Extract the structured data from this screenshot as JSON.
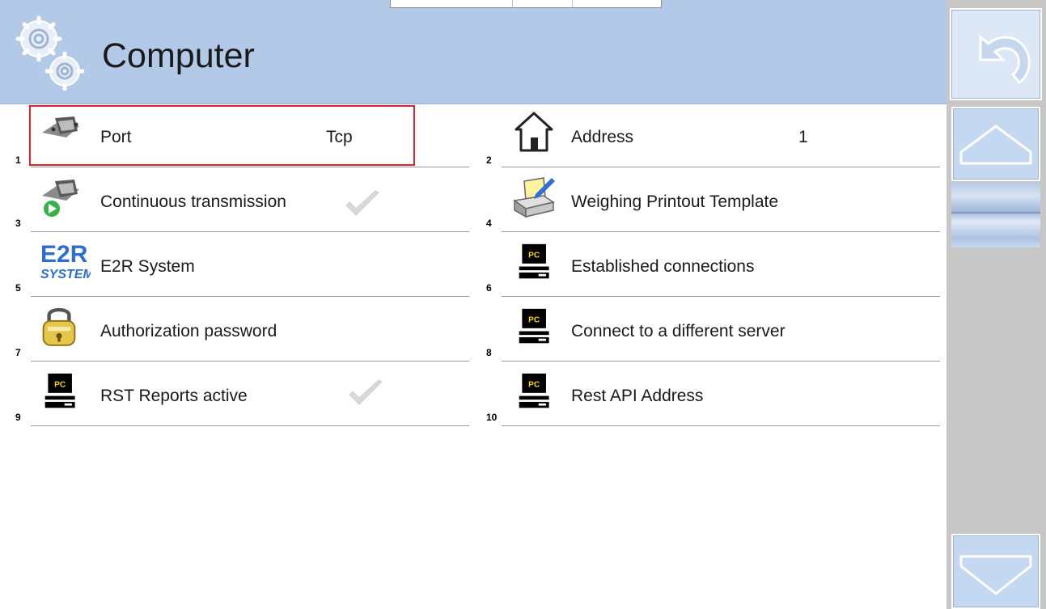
{
  "header": {
    "title": "Computer"
  },
  "items": [
    {
      "num": "1",
      "label": "Port",
      "value": "Tcp",
      "icon": "serial-port-icon",
      "checked": false
    },
    {
      "num": "2",
      "label": "Address",
      "value": "1",
      "icon": "home-icon",
      "checked": false
    },
    {
      "num": "3",
      "label": "Continuous transmission",
      "value": "",
      "icon": "serial-port-play-icon",
      "checked": true
    },
    {
      "num": "4",
      "label": "Weighing Printout Template",
      "value": "",
      "icon": "printer-edit-icon",
      "checked": false
    },
    {
      "num": "5",
      "label": "E2R System",
      "value": "",
      "icon": "e2r-logo-icon",
      "checked": false
    },
    {
      "num": "6",
      "label": "Established connections",
      "value": "",
      "icon": "pc-icon",
      "checked": false
    },
    {
      "num": "7",
      "label": "Authorization password",
      "value": "",
      "icon": "padlock-icon",
      "checked": false
    },
    {
      "num": "8",
      "label": "Connect to a different server",
      "value": "",
      "icon": "pc-icon",
      "checked": false
    },
    {
      "num": "9",
      "label": "RST Reports active",
      "value": "",
      "icon": "pc-icon",
      "checked": true
    },
    {
      "num": "10",
      "label": "Rest API Address",
      "value": "",
      "icon": "pc-icon",
      "checked": false
    }
  ],
  "icon_text": {
    "pc": "PC",
    "e2r_top": "E2R",
    "e2r_bottom": "SYSTEM"
  },
  "colors": {
    "header_bg": "#b3c9e8",
    "selection_border": "#e0242c",
    "side_button": "#c5d8f1"
  }
}
